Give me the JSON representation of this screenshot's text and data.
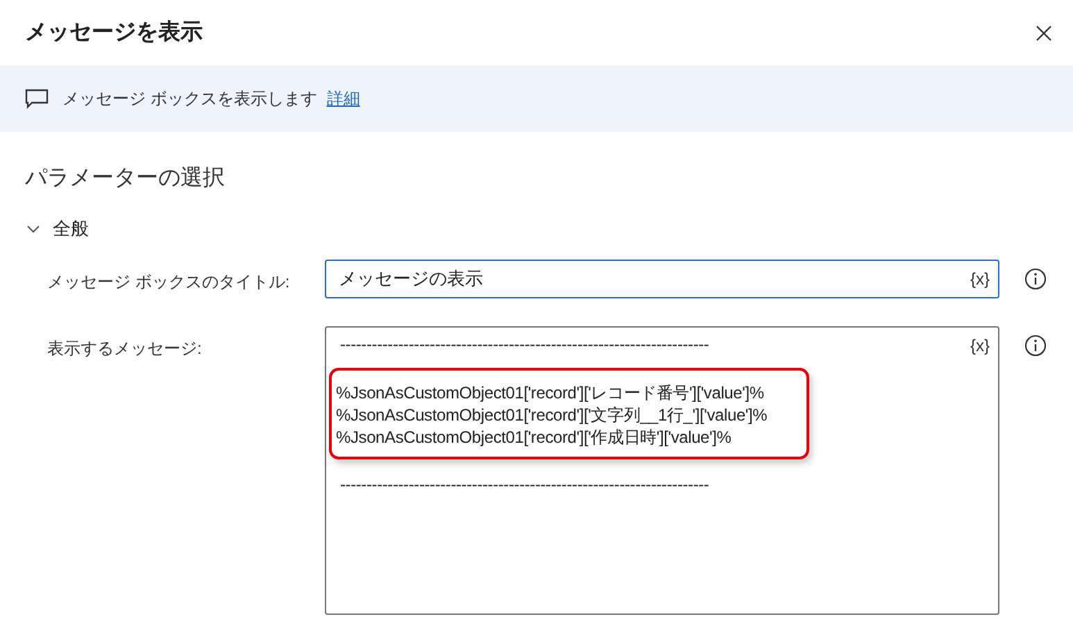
{
  "window": {
    "title": "メッセージを表示"
  },
  "banner": {
    "text": "メッセージ ボックスを表示します",
    "link": "詳細"
  },
  "section_title": "パラメーターの選択",
  "group": {
    "label": "全般",
    "expanded": true
  },
  "fields": [
    {
      "kind": "input",
      "label": "メッセージ ボックスのタイトル:",
      "value": "メッセージの表示",
      "focused": true,
      "variable_button": "{x}"
    },
    {
      "kind": "multiline",
      "label": "表示するメッセージ:",
      "focused": false,
      "variable_button": "{x}",
      "blocks": [
        {
          "highlighted": false,
          "lines": [
            "----------------------------------------------------------------------"
          ]
        },
        {
          "highlighted": true,
          "lines": [
            "%JsonAsCustomObject01['record']['レコード番号']['value']%",
            "%JsonAsCustomObject01['record']['文字列__1行_']['value']%",
            "%JsonAsCustomObject01['record']['作成日時']['value']%"
          ]
        },
        {
          "highlighted": false,
          "lines": [
            "----------------------------------------------------------------------"
          ]
        }
      ]
    }
  ]
}
